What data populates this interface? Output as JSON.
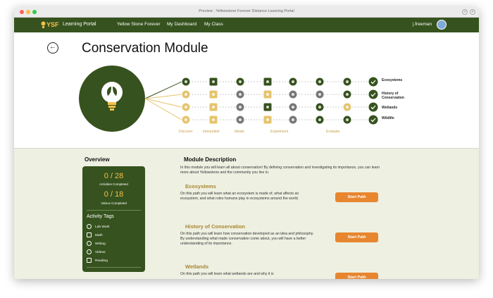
{
  "window": {
    "title": "Preview : Yellowstone Forever Distance Learning Portal",
    "traffic_colors": [
      "#fc605c",
      "#fdbc40",
      "#34c84a"
    ]
  },
  "nav": {
    "logo": "YSF",
    "logo_sub": "Learning Portal",
    "links": [
      "Yellow Stone Forever",
      "My Dashboard",
      "My Class"
    ],
    "username": "j.freeman"
  },
  "page": {
    "title": "Conservation Module"
  },
  "pathway": {
    "paths": [
      {
        "name": "Ecosystems",
        "completed": [
          true,
          true,
          true,
          true,
          true,
          true,
          true
        ]
      },
      {
        "name": "History of Conservation",
        "completed": [
          false,
          false,
          false,
          false,
          false,
          false,
          true
        ]
      },
      {
        "name": "Wetlands",
        "completed": [
          false,
          false,
          false,
          true,
          false,
          true,
          false
        ]
      },
      {
        "name": "Wildlife",
        "completed": [
          false,
          false,
          false,
          false,
          false,
          true,
          true
        ]
      }
    ],
    "stages": [
      "Discover",
      "Interpolate",
      "Ideate",
      "Experiment",
      "Evaluate"
    ],
    "colors": {
      "done": "#36521e",
      "gray": "#777777",
      "gold": "#e5c46e"
    }
  },
  "overview": {
    "title": "Overview",
    "activities_value": "0 / 28",
    "activities_label": "Activities Completed",
    "videos_value": "0 / 18",
    "videos_label": "Videos Completed",
    "tags_title": "Activity Tags",
    "tags": [
      {
        "label": "Lab Work",
        "icon": "lab-icon"
      },
      {
        "label": "Math",
        "icon": "calculator-icon"
      },
      {
        "label": "Writing",
        "icon": "pencil-icon"
      },
      {
        "label": "Videos",
        "icon": "play-icon"
      },
      {
        "label": "Reading",
        "icon": "book-icon"
      }
    ]
  },
  "module": {
    "title": "Module Description",
    "description": "In this module you will learn all about conservation! By defining conservation and investigating its importance, you can learn more about Yellowstone and the community you live in.",
    "paths": [
      {
        "title": "Ecosystems",
        "text": "On this path you will learn what an ecosystem is made of, what affects an ecosystem, and what roles humans play in ecosystems around the world.",
        "button": "Start Path"
      },
      {
        "title": "History of Conservation",
        "text": "On this path you will learn how conservation developed as an idea and philosophy. By understanding what made conservation come about, you will have a better understanding of its importance.",
        "button": "Start Path"
      },
      {
        "title": "Wetlands",
        "text": "On this path you will learn what wetlands are and why it is",
        "button": "Start Path"
      }
    ]
  }
}
